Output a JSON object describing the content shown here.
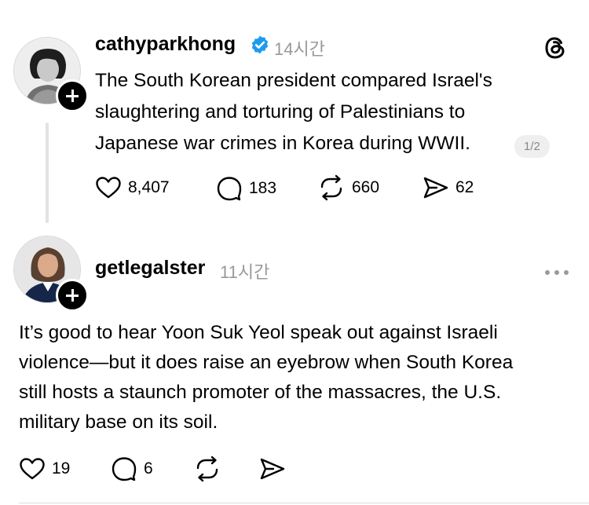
{
  "post1": {
    "username": "cathyparkhong",
    "verified": true,
    "time": "14시간",
    "text_lines": [
      "The South Korean president compared Israel's",
      "slaughtering and torturing of Palestinians to",
      "Japanese war crimes in Korea during WWII."
    ],
    "page_badge": "1/2",
    "likes": "8,407",
    "replies": "183",
    "reposts": "660",
    "shares": "62",
    "verified_color": "#1d9bf0"
  },
  "post2": {
    "username": "getlegalster",
    "time": "11시간",
    "text_lines": [
      "It’s good to hear Yoon Suk Yeol speak out against Israeli",
      "violence—but it does raise an eyebrow when South Korea",
      "still hosts a staunch promoter of the massacres, the U.S.",
      "military base on its soil."
    ],
    "likes": "19",
    "replies": "6"
  },
  "icons": {
    "app_logo": "threads-icon",
    "more": "more-icon"
  }
}
